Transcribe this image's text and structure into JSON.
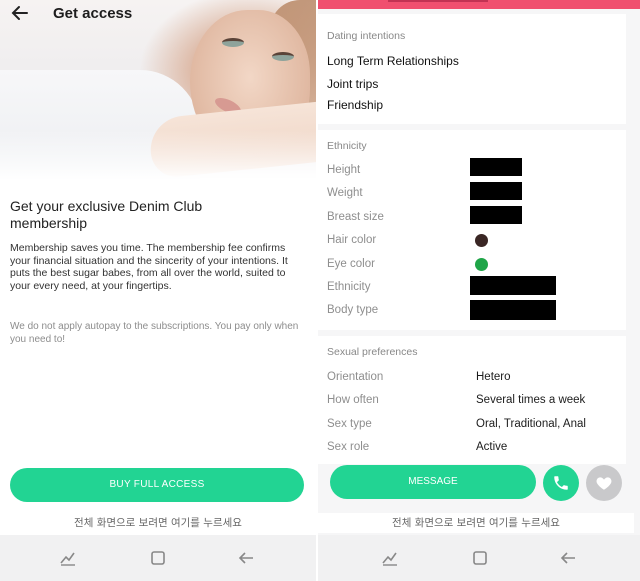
{
  "left": {
    "header": {
      "title": "Get access"
    },
    "heading": "Get your exclusive Denim Club membership",
    "body": "Membership saves you time. The membership fee confirms your financial situation and the sincerity of your intentions. It puts the best sugar babes, from all over the world, suited to your every need, at your fingertips.",
    "note": "We do not apply autopay to the subscriptions. You pay only when you need to!",
    "buy_button": "BUY FULL ACCESS",
    "fullscreen_hint": "전체 화면으로 보려면 여기를 누르세요"
  },
  "right": {
    "intentions": {
      "label": "Dating intentions",
      "items": [
        "Long Term Relationships",
        "Joint trips",
        "Friendship"
      ]
    },
    "ethnicity_section": {
      "label": "Ethnicity",
      "rows": [
        {
          "label": "Height"
        },
        {
          "label": "Weight"
        },
        {
          "label": "Breast size"
        },
        {
          "label": "Hair color",
          "color": "#3a2624"
        },
        {
          "label": "Eye color",
          "color": "#1fa548"
        },
        {
          "label": "Ethnicity"
        },
        {
          "label": "Body type"
        }
      ]
    },
    "sexual": {
      "label": "Sexual preferences",
      "rows": [
        {
          "label": "Orientation",
          "value": "Hetero"
        },
        {
          "label": "How often",
          "value": "Several times a week"
        },
        {
          "label": "Sex type",
          "value": "Oral, Traditional, Anal"
        },
        {
          "label": "Sex role",
          "value": "Active"
        }
      ]
    },
    "message_button": "MESSAGE",
    "fullscreen_hint": "전체 화면으로 보려면 여기를 누르세요"
  },
  "colors": {
    "accent": "#22d493",
    "topbar": "#f04f6f",
    "heart_bg": "#c9c9cb"
  },
  "icons": [
    "back-arrow-icon",
    "phone-icon",
    "heart-icon",
    "recents-icon",
    "home-icon",
    "nav-back-icon"
  ]
}
